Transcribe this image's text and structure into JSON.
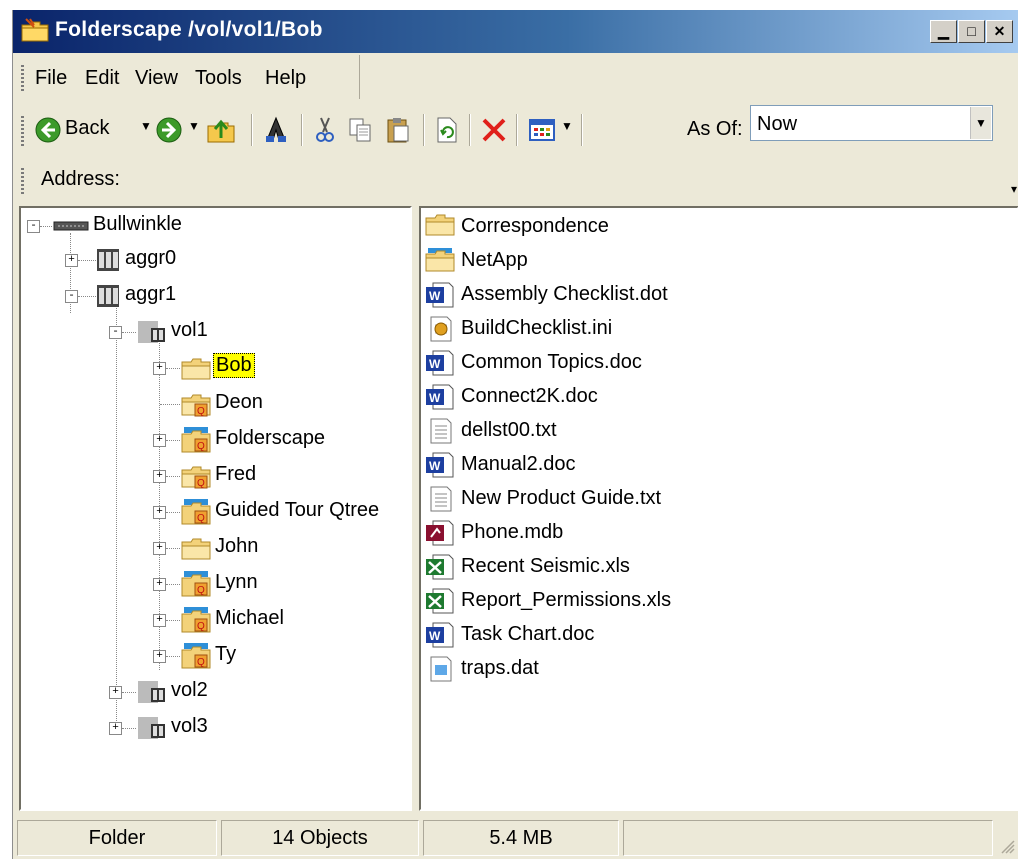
{
  "window": {
    "title": "Folderscape  /vol/vol1/Bob"
  },
  "menu": [
    "File",
    "Edit",
    "View",
    "Tools",
    "Help"
  ],
  "toolbar": {
    "back_label": "Back",
    "asof_label": "As Of:",
    "asof_value": "Now"
  },
  "address": {
    "label": "Address:"
  },
  "tree": [
    {
      "label": "Bullwinkle"
    },
    {
      "label": "aggr0"
    },
    {
      "label": "aggr1"
    },
    {
      "label": "vol1"
    },
    {
      "label": "Bob"
    },
    {
      "label": "Deon"
    },
    {
      "label": "Folderscape"
    },
    {
      "label": "Fred"
    },
    {
      "label": "Guided Tour Qtree"
    },
    {
      "label": "John"
    },
    {
      "label": "Lynn"
    },
    {
      "label": "Michael"
    },
    {
      "label": "Ty"
    },
    {
      "label": "vol2"
    },
    {
      "label": "vol3"
    }
  ],
  "files": [
    {
      "name": "Correspondence",
      "icon": "folder"
    },
    {
      "name": "NetApp",
      "icon": "shared-folder"
    },
    {
      "name": "Assembly Checklist.dot",
      "icon": "word"
    },
    {
      "name": "BuildChecklist.ini",
      "icon": "ini"
    },
    {
      "name": "Common Topics.doc",
      "icon": "word"
    },
    {
      "name": "Connect2K.doc",
      "icon": "word"
    },
    {
      "name": "dellst00.txt",
      "icon": "text"
    },
    {
      "name": "Manual2.doc",
      "icon": "word"
    },
    {
      "name": "New Product Guide.txt",
      "icon": "text"
    },
    {
      "name": "Phone.mdb",
      "icon": "access"
    },
    {
      "name": "Recent Seismic.xls",
      "icon": "excel"
    },
    {
      "name": "Report_Permissions.xls",
      "icon": "excel"
    },
    {
      "name": "Task Chart.doc",
      "icon": "word"
    },
    {
      "name": "traps.dat",
      "icon": "data"
    }
  ],
  "status": {
    "type": "Folder",
    "count": "14 Objects",
    "size": "5.4 MB",
    "extra": ""
  }
}
